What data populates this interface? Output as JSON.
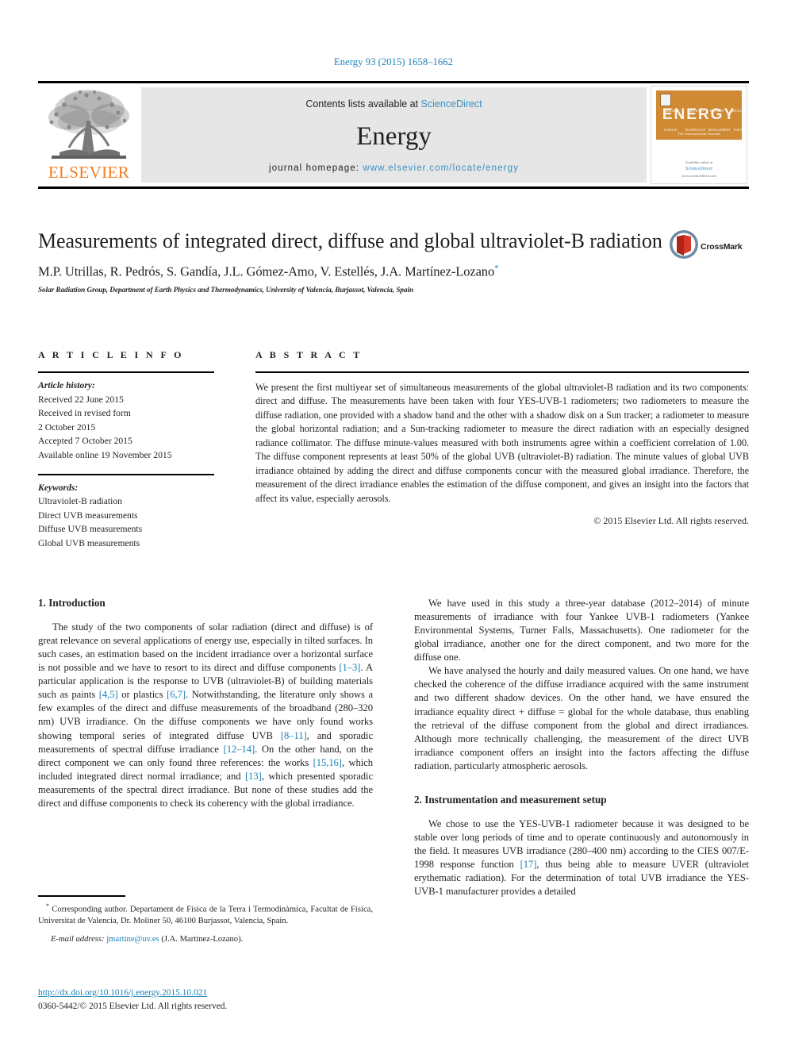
{
  "running_head": "Energy 93 (2015) 1658–1662",
  "masthead": {
    "contents_prefix": "Contents lists available at ",
    "sciencedirect": "ScienceDirect",
    "journal_title": "Energy",
    "homepage_prefix": "journal homepage: ",
    "homepage_url": "www.elsevier.com/locate/energy",
    "publisher": "ELSEVIER",
    "cover": {
      "title": "ENERGY",
      "subtitle": "The International Journal",
      "ticks": [
        "INDEXED",
        "ABSTRACT",
        "REVIEWS",
        "ARTICLES"
      ],
      "ticks_bottom": [
        "SCIENCE",
        "TECHNOLOGY",
        "MANAGEMENT",
        "POLICY"
      ],
      "footer_line1": "Available online at",
      "footer_line2": "ScienceDirect",
      "footer_line3": "www.sciencedirect.com"
    }
  },
  "article": {
    "title": "Measurements of integrated direct, diffuse and global ultraviolet-B radiation",
    "authors": "M.P. Utrillas, R. Pedrós, S. Gandía, J.L. Gómez-Amo, V. Estellés, J.A. Martínez-Lozano",
    "corresponding_marker": "*",
    "affiliation": "Solar Radiation Group, Department of Earth Physics and Thermodynamics, University of Valencia, Burjassot, Valencia, Spain",
    "crossmark_label": "CrossMark"
  },
  "article_info": {
    "heading": "A R T I C L E   I N F O",
    "history_label": "Article history:",
    "history": [
      "Received 22 June 2015",
      "Received in revised form",
      "2 October 2015",
      "Accepted 7 October 2015",
      "Available online 19 November 2015"
    ],
    "keywords_label": "Keywords:",
    "keywords": [
      "Ultraviolet-B radiation",
      "Direct UVB measurements",
      "Diffuse UVB measurements",
      "Global UVB measurements"
    ]
  },
  "abstract": {
    "heading": "A B S T R A C T",
    "text": "We present the first multiyear set of simultaneous measurements of the global ultraviolet-B radiation and its two components: direct and diffuse. The measurements have been taken with four YES-UVB-1 radiometers; two radiometers to measure the diffuse radiation, one provided with a shadow band and the other with a shadow disk on a Sun tracker; a radiometer to measure the global horizontal radiation; and a Sun-tracking radiometer to measure the direct radiation with an especially designed radiance collimator. The diffuse minute-values measured with both instruments agree within a coefficient correlation of 1.00. The diffuse component represents at least 50% of the global UVB (ultraviolet-B) radiation. The minute values of global UVB irradiance obtained by adding the direct and diffuse components concur with the measured global irradiance. Therefore, the measurement of the direct irradiance enables the estimation of the diffuse component, and gives an insight into the factors that affect its value, especially aerosols.",
    "copyright": "© 2015 Elsevier Ltd. All rights reserved."
  },
  "sections": {
    "intro_heading": "1. Introduction",
    "intro_p1_a": "The study of the two components of solar radiation (direct and diffuse) is of great relevance on several applications of energy use, especially in tilted surfaces. In such cases, an estimation based on the incident irradiance over a horizontal surface is not possible and we have to resort to its direct and diffuse components ",
    "intro_p1_ref1": "[1–3]",
    "intro_p1_b": ". A particular application is the response to UVB (ultraviolet-B) of building materials such as paints ",
    "intro_p1_ref2": "[4,5]",
    "intro_p1_c": " or plastics ",
    "intro_p1_ref3": "[6,7]",
    "intro_p1_d": ". Notwithstanding, the literature only shows a few examples of the direct and diffuse measurements of the broadband (280–320 nm) UVB irradiance. On the diffuse components we have only found works showing temporal series of integrated diffuse UVB ",
    "intro_p1_ref4": "[8–11]",
    "intro_p1_e": ", and sporadic measurements of spectral diffuse irradiance ",
    "intro_p1_ref5": "[12–14]",
    "intro_p1_f": ". On the other hand, on the direct component we can only found three references: the works ",
    "intro_p1_ref6": "[15,16]",
    "intro_p1_g": ", which included integrated direct normal irradiance; and ",
    "intro_p1_ref7": "[13]",
    "intro_p1_h": ", which presented sporadic measurements of the spectral direct irradiance. But none of these studies add the direct and diffuse components to check its coherency with the global irradiance.",
    "right_p1": "We have used in this study a three-year database (2012–2014) of minute measurements of irradiance with four Yankee UVB-1 radiometers (Yankee Environmental Systems, Turner Falls, Massachusetts). One radiometer for the global irradiance, another one for the direct component, and two more for the diffuse one.",
    "right_p2": "We have analysed the hourly and daily measured values. On one hand, we have checked the coherence of the diffuse irradiance acquired with the same instrument and two different shadow devices. On the other hand, we have ensured the irradiance equality direct + diffuse = global for the whole database, thus enabling the retrieval of the diffuse component from the global and direct irradiances. Although more technically challenging, the measurement of the direct UVB irradiance component offers an insight into the factors affecting the diffuse radiation, particularly atmospheric aerosols.",
    "setup_heading": "2. Instrumentation and measurement setup",
    "setup_p1_a": "We chose to use the YES-UVB-1 radiometer because it was designed to be stable over long periods of time and to operate continuously and autonomously in the field. It measures UVB irradiance (280–400 nm) according to the CIES 007/E-1998 response function ",
    "setup_p1_ref1": "[17]",
    "setup_p1_b": ", thus being able to measure UVER (ultraviolet erythematic radiation). For the determination of total UVB irradiance the YES-UVB-1 manufacturer provides a detailed"
  },
  "footnote": {
    "star": "*",
    "text": " Corresponding author. Departament de Física de la Terra i Termodinàmica, Facultat de Física, Universitat de Valencia, Dr. Moliner 50, 46100 Burjassot, Valencia, Spain.",
    "email_label": "E-mail address:",
    "email": "jmartine@uv.es",
    "email_owner": "(J.A. Martínez-Lozano)."
  },
  "footer": {
    "doi": "http://dx.doi.org/10.1016/j.energy.2015.10.021",
    "issn_copyright": "0360-5442/© 2015 Elsevier Ltd. All rights reserved."
  },
  "colors": {
    "link": "#1a7fb5",
    "sciencedirect": "#3a8fc4",
    "elsevier_orange": "#f47c20",
    "cover_orange": "#d08a34",
    "band_grey": "#e6e6e6"
  }
}
